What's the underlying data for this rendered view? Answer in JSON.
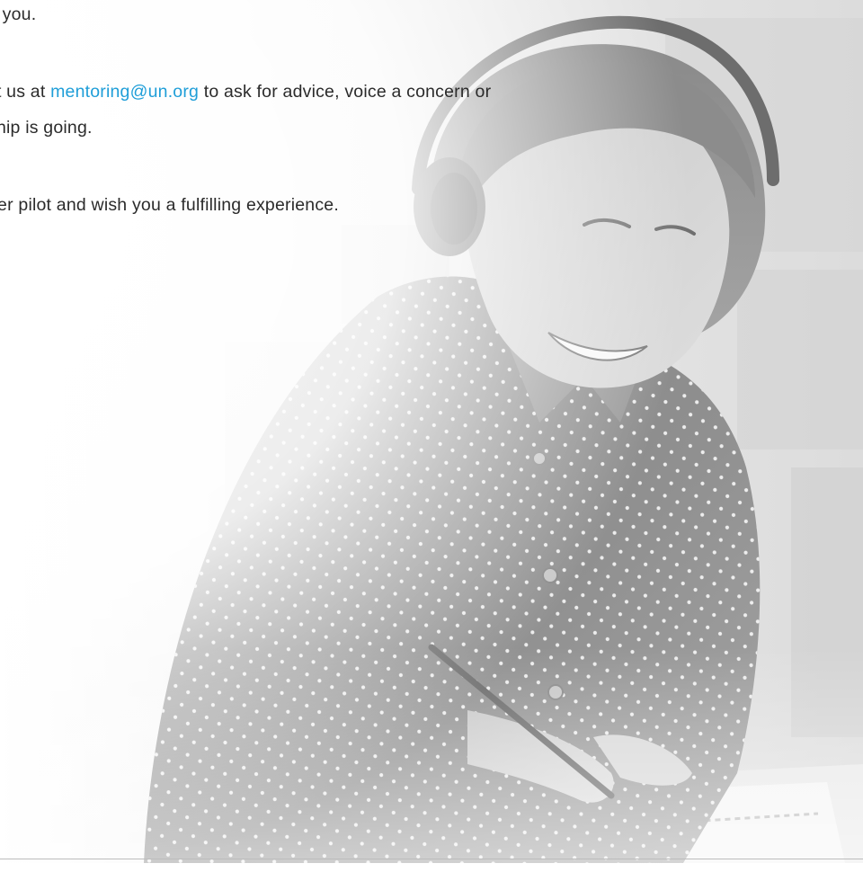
{
  "message": {
    "line1": "e you.",
    "line2_prefix": "ct us at",
    "email": "mentoring@un.org",
    "line2_suffix": "to ask for advice, voice a concern or",
    "line3": "ship is going.",
    "line4": "her pilot and wish you a fulfilling experience."
  },
  "hero_image": {
    "description_icon": "woman-with-headphones-writing-photo"
  },
  "colors": {
    "link": "#1f9ed8",
    "text": "#2b2b2b",
    "divider": "#bcbcbc"
  }
}
